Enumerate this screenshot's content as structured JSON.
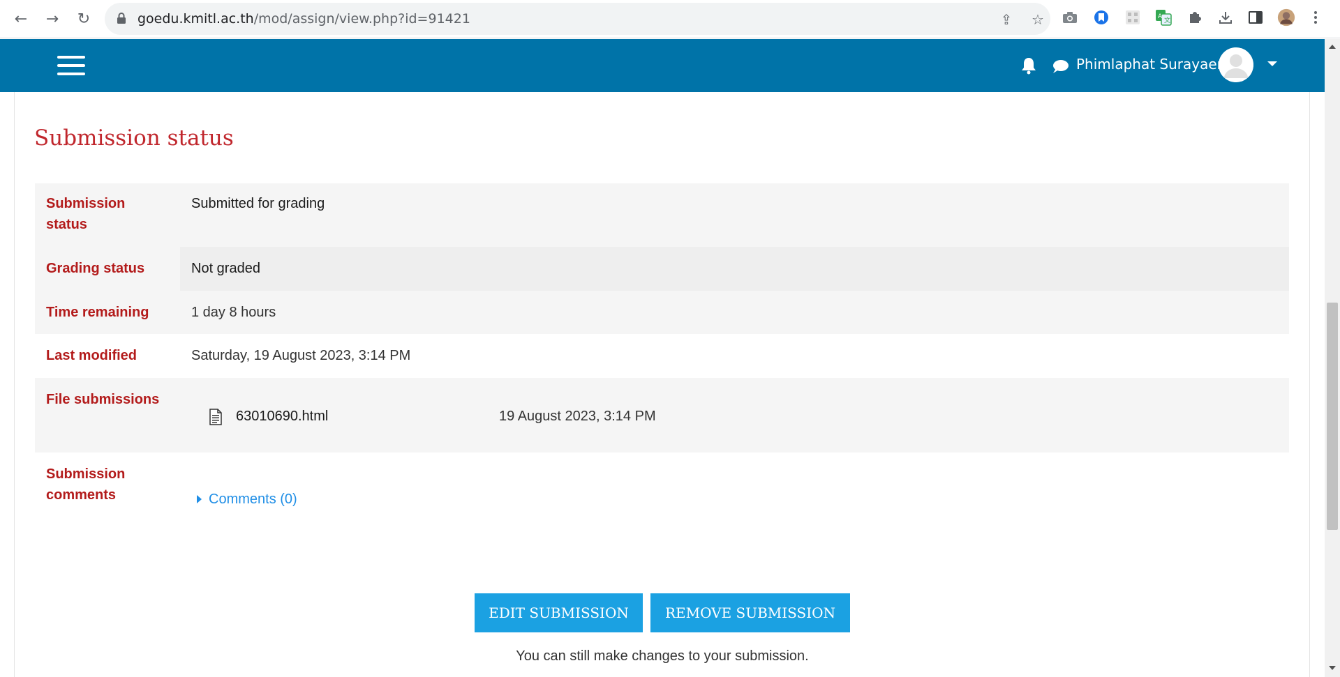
{
  "browser": {
    "url_domain": "goedu.kmitl.ac.th",
    "url_path": "/mod/assign/view.php?id=91421"
  },
  "navbar": {
    "user_name": "Phimlaphat Surayaem",
    "brand_color": "#0073a8"
  },
  "page": {
    "heading": "Submission status",
    "rows": {
      "submission_status": {
        "label": "Submission status",
        "value": "Submitted for grading"
      },
      "grading_status": {
        "label": "Grading status",
        "value": "Not graded"
      },
      "time_remaining": {
        "label": "Time remaining",
        "value": "1 day 8 hours"
      },
      "last_modified": {
        "label": "Last modified",
        "value": "Saturday, 19 August 2023, 3:14 PM"
      },
      "file_submissions": {
        "label": "File submissions",
        "file_name": "63010690.html",
        "file_date": "19 August 2023, 3:14 PM"
      },
      "submission_comments": {
        "label": "Submission comments",
        "link": "Comments (0)"
      }
    },
    "buttons": {
      "edit": "EDIT SUBMISSION",
      "remove": "REMOVE SUBMISSION"
    },
    "note": "You can still make changes to your submission."
  },
  "colors": {
    "heading": "#c0262c",
    "label": "#b31b1b",
    "button": "#1ba1e2",
    "link": "#1f8ee6"
  }
}
